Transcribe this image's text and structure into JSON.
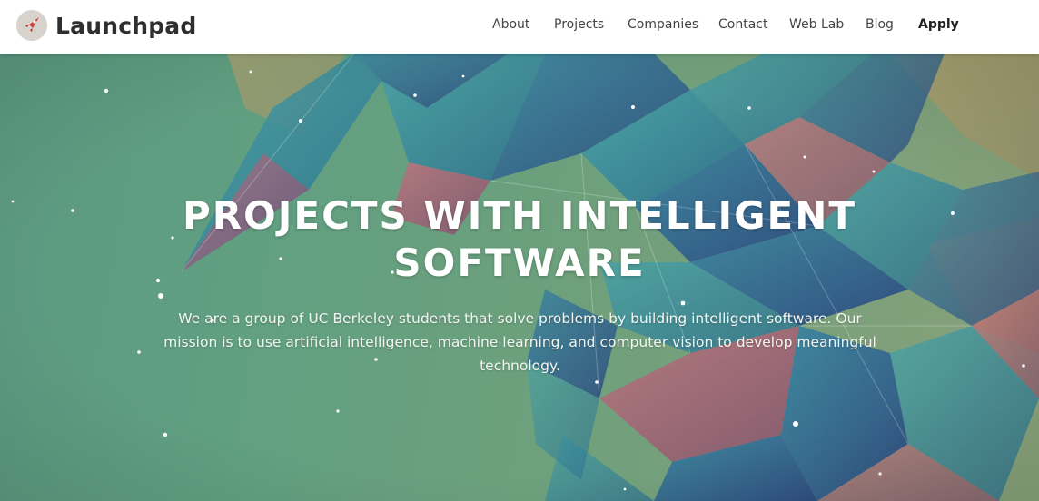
{
  "brand": {
    "name": "Launchpad",
    "logo_icon": "rocket-icon"
  },
  "nav": {
    "items": [
      {
        "label": "About"
      },
      {
        "label": "Projects"
      },
      {
        "label": "Companies"
      },
      {
        "label": "Contact"
      },
      {
        "label": "Web Lab"
      },
      {
        "label": "Blog"
      },
      {
        "label": "Apply"
      }
    ]
  },
  "hero": {
    "title_line1": "PROJECTS WITH INTELLIGENT",
    "title_line2": "SOFTWARE",
    "description": "We are a group of UC Berkeley students that solve problems by building intelligent software. Our mission is to use artificial intelligence, machine learning, and computer vision to develop meaningful technology."
  },
  "colors": {
    "accent": "#d9413a",
    "hero_green": "#5e9a7e",
    "facet_blue": "#2f5a8f",
    "facet_teal": "#3a8f9a",
    "facet_pink": "#c45a78"
  }
}
